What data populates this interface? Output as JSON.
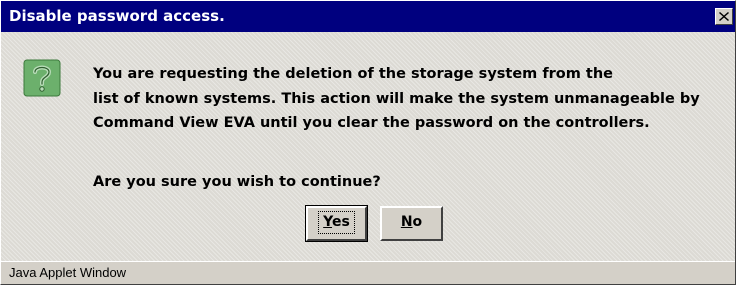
{
  "window": {
    "title": "Disable password access.",
    "close_icon": "close-icon"
  },
  "dialog": {
    "icon": "question-icon",
    "icon_glyph": "?",
    "message_lines": [
      "You are requesting the deletion of the storage system from the",
      "list of known systems. This action will make the system unmanageable by",
      "Command View EVA until you clear the password on the controllers."
    ],
    "confirm_text": "Are you sure you wish to continue?"
  },
  "buttons": {
    "yes": {
      "mnemonic": "Y",
      "rest": "es"
    },
    "no": {
      "mnemonic": "N",
      "rest": "o"
    }
  },
  "statusbar": {
    "text": "Java Applet Window"
  },
  "colors": {
    "titlebar_bg": "#00007f",
    "titlebar_text": "#ffffff",
    "window_bg": "#d4d0c8",
    "icon_fill": "#6cb06c"
  }
}
